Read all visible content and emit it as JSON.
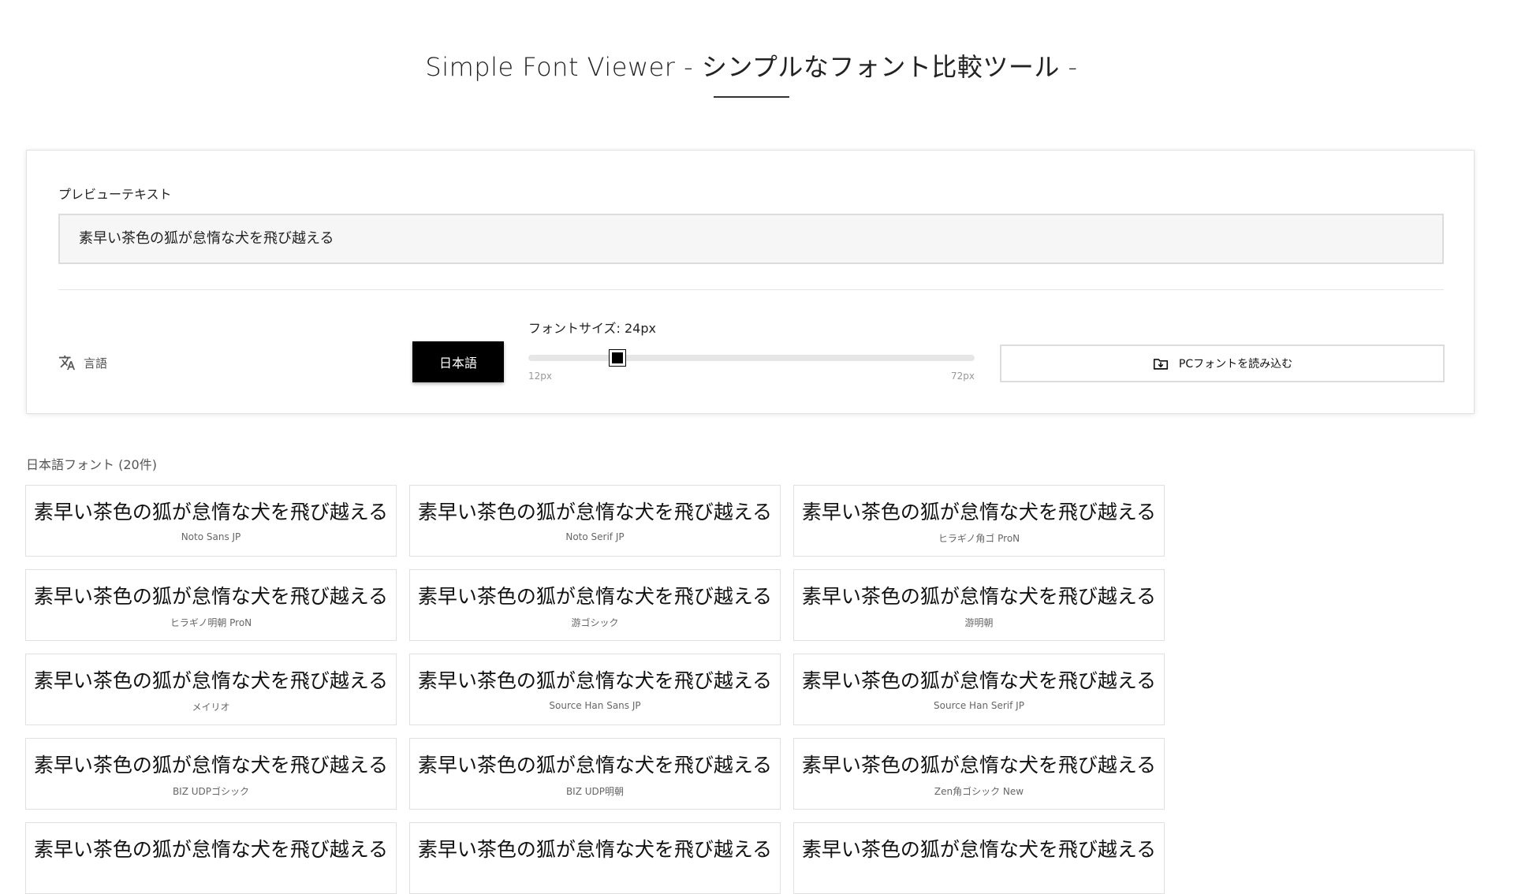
{
  "header": {
    "title": "Simple Font Viewer - シンプルなフォント比較ツール -"
  },
  "controls": {
    "preview_label": "プレビューテキスト",
    "preview_value": "素早い茶色の狐が怠惰な犬を飛び越える",
    "language_label": "言語",
    "language_button": "日本語",
    "font_size_label": "フォントサイズ: 24px",
    "font_size": {
      "value": 24,
      "min": 12,
      "max": 72
    },
    "slider_min_label": "12px",
    "slider_max_label": "72px",
    "load_font_button": "PCフォントを読み込む",
    "icons": {
      "language": "translate-icon",
      "load": "folder-download-icon"
    }
  },
  "font_section": {
    "heading": "日本語フォント (20件)",
    "sample_text": "素早い茶色の狐が怠惰な犬を飛び越える",
    "fonts": [
      "Noto Sans JP",
      "Noto Serif JP",
      "ヒラギノ角ゴ ProN",
      "ヒラギノ明朝 ProN",
      "游ゴシック",
      "游明朝",
      "メイリオ",
      "Source Han Sans JP",
      "Source Han Serif JP",
      "BIZ UDPゴシック",
      "BIZ UDP明朝",
      "Zen角ゴシック New",
      "",
      "",
      ""
    ]
  }
}
